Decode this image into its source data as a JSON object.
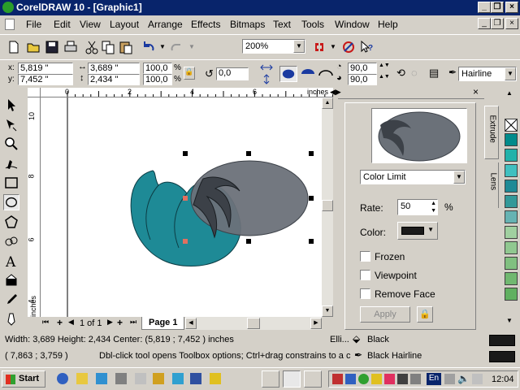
{
  "title": "CorelDRAW 10 - [Graphic1]",
  "menu": [
    "File",
    "Edit",
    "View",
    "Layout",
    "Arrange",
    "Effects",
    "Bitmaps",
    "Text",
    "Tools",
    "Window",
    "Help"
  ],
  "toolbar": {
    "zoom": "200%"
  },
  "property_bar": {
    "x": "5,819 \"",
    "y": "7,452 \"",
    "width": "3,689 \"",
    "height": "2,434 \"",
    "scale_x": "100,0",
    "scale_y": "100,0",
    "scale_unit": "%",
    "rotation": "0,0",
    "angle_start": "90,0",
    "angle_end": "90,0",
    "outline_width": "Hairline"
  },
  "rulers": {
    "h_ticks": [
      "0",
      "2",
      "4",
      "6"
    ],
    "h_unit": "inches",
    "v_ticks": [
      "10",
      "8",
      "6",
      "4"
    ],
    "v_unit": "inches"
  },
  "page_nav": {
    "page_count": "1 of 1",
    "page_tab": "Page 1"
  },
  "docker": {
    "lens_type": "Color Limit",
    "rate_label": "Rate:",
    "rate_value": "50",
    "rate_unit": "%",
    "color_label": "Color:",
    "color_value": "#1a1a1a",
    "options": [
      {
        "label": "Frozen",
        "checked": false
      },
      {
        "label": "Viewpoint",
        "checked": false
      },
      {
        "label": "Remove Face",
        "checked": false
      }
    ],
    "apply_label": "Apply",
    "tabs": [
      "Extrude",
      "Lens"
    ]
  },
  "colors": {
    "teal": "#1e8a96",
    "lens_gray": "#6b7179",
    "dark": "#3c4148"
  },
  "palette": [
    "#ffffff",
    "#008b8b",
    "#20b2aa",
    "#40c0c0",
    "#1e8a96",
    "#339999",
    "#66b3b3",
    "#a0d0a0",
    "#90c890",
    "#80c080",
    "#70b870",
    "#60b060"
  ],
  "status": {
    "line1": "Width: 3,689  Height: 2,434  Center: (5,819 ; 7,452 )  inches",
    "object_type": "Elli...",
    "fill": "Black",
    "line2_coords": "( 7,863 ; 3,759 )",
    "line2_hint": "Dbl-click tool opens Toolbox options; Ctrl+drag constrains to a ci...",
    "outline": "Black  Hairline"
  },
  "taskbar": {
    "start": "Start",
    "lang": "En",
    "clock": "12:04"
  }
}
